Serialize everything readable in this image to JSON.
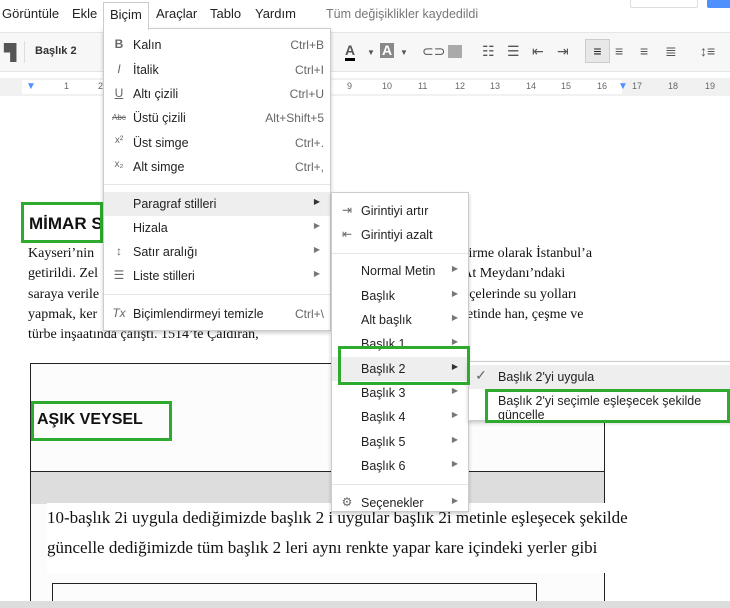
{
  "menubar": {
    "items": [
      "Görüntüle",
      "Ekle",
      "Biçim",
      "Araçlar",
      "Tablo",
      "Yardım"
    ],
    "status": "Tüm değişiklikler kaydedildi"
  },
  "toolbar": {
    "style_value": "Başlık 2"
  },
  "ruler": {
    "ticks": [
      "1",
      "2",
      "9",
      "10",
      "11",
      "12",
      "13",
      "14",
      "15",
      "16",
      "17",
      "18",
      "19"
    ]
  },
  "format_menu": {
    "items": [
      {
        "icon": "bold-icon",
        "glyph": "B",
        "label": "Kalın",
        "shortcut": "Ctrl+B"
      },
      {
        "icon": "italic-icon",
        "glyph": "I",
        "label": "İtalik",
        "shortcut": "Ctrl+I"
      },
      {
        "icon": "underline-icon",
        "glyph": "U",
        "label": "Altı çizili",
        "shortcut": "Ctrl+U"
      },
      {
        "icon": "strikethrough-icon",
        "glyph": "Abc",
        "label": "Üstü çizili",
        "shortcut": "Alt+Shift+5"
      },
      {
        "icon": "superscript-icon",
        "glyph": "x²",
        "label": "Üst simge",
        "shortcut": "Ctrl+."
      },
      {
        "icon": "subscript-icon",
        "glyph": "x₂",
        "label": "Alt simge",
        "shortcut": "Ctrl+,"
      },
      {
        "label": "Paragraf stilleri",
        "submenu": true
      },
      {
        "label": "Hizala",
        "submenu": true
      },
      {
        "icon": "line-spacing-icon",
        "glyph": "↕",
        "label": "Satır aralığı",
        "submenu": true
      },
      {
        "icon": "list-icon",
        "glyph": "☰",
        "label": "Liste stilleri",
        "submenu": true
      },
      {
        "icon": "clear-formatting-icon",
        "glyph": "Tx",
        "label": "Biçimlendirmeyi temizle",
        "shortcut": "Ctrl+\\"
      }
    ]
  },
  "paragraph_menu": {
    "items": [
      "Girintiyi artır",
      "Girintiyi azalt",
      "Normal Metin",
      "Başlık",
      "Alt başlık",
      "Başlık 1",
      "Başlık 2",
      "Başlık 3",
      "Başlık 4",
      "Başlık 5",
      "Başlık 6",
      "Seçenekler"
    ]
  },
  "heading2_menu": {
    "items": [
      "Başlık 2'yi uygula",
      "Başlık 2'yi seçimle eşleşecek şekilde güncelle"
    ]
  },
  "document": {
    "heading1": "MİMAR S",
    "paragraph": [
      "Kayseri’nin",
      "vşirme olarak İstanbul’a",
      "getirildi. Zel",
      ", At Meydanı’ndaki",
      "saraya verile",
      "ahçelerinde su yolları",
      "yapmak, ker",
      "iyetinde han, çeşme ve",
      "türbe inşaatında çalıştı. 1514’te Çaldıran,"
    ],
    "heading2": "AŞIK VEYSEL",
    "annotation": [
      "10-başlık 2i uygula dediğimizde başlık 2 i uygular başlık 2i metinle  eşleşecek şekilde",
      "güncelle dediğimizde tüm başlık 2 leri aynı renkte yapar kare içindeki yerler gibi"
    ]
  },
  "colors": {
    "highlight_box": "#2eaa2e",
    "accent": "#4d90fe"
  }
}
